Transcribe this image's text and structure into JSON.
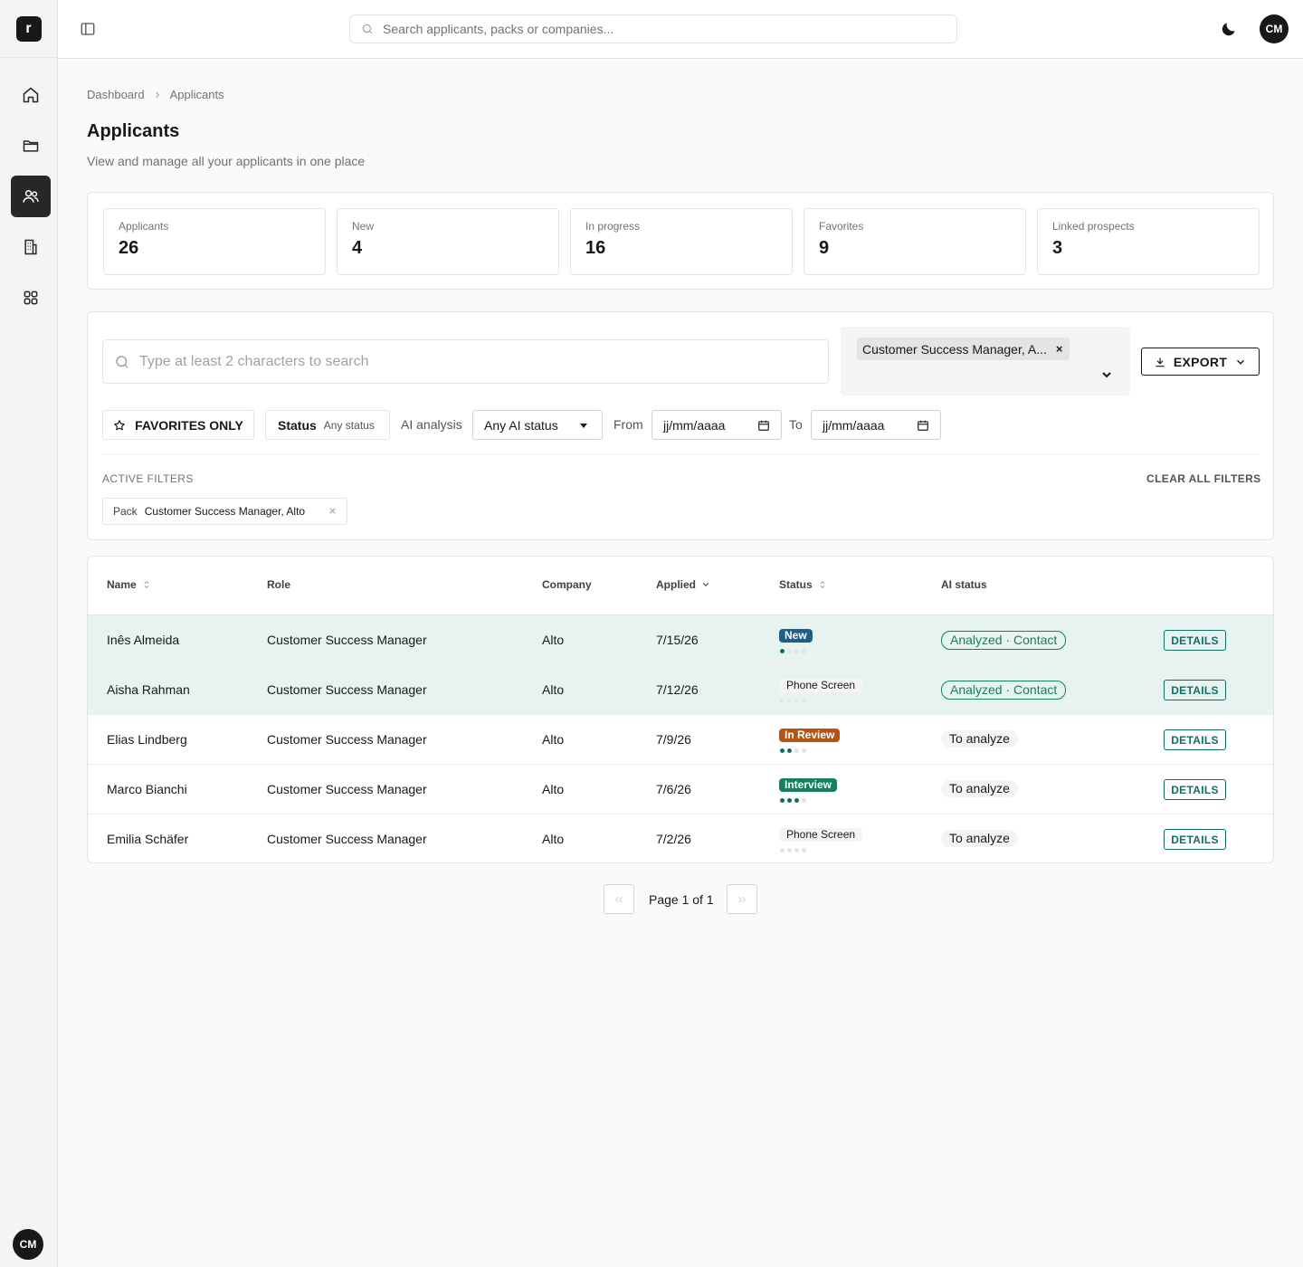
{
  "app": {
    "logo_letter": "r"
  },
  "sidebar": {
    "items": [
      {
        "name": "home",
        "icon": "home-icon"
      },
      {
        "name": "packs",
        "icon": "folder-icon"
      },
      {
        "name": "applicants",
        "icon": "users-icon",
        "active": true
      },
      {
        "name": "companies",
        "icon": "building-icon"
      },
      {
        "name": "apps",
        "icon": "grid-icon"
      }
    ],
    "avatar_initials": "CM"
  },
  "header": {
    "search_placeholder": "Search applicants, packs or companies...",
    "avatar_initials": "CM"
  },
  "breadcrumb": [
    "Dashboard",
    "Applicants"
  ],
  "page": {
    "title": "Applicants",
    "subtitle": "View and manage all your applicants in one place"
  },
  "stats": [
    {
      "label": "Applicants",
      "value": "26"
    },
    {
      "label": "New",
      "value": "4"
    },
    {
      "label": "In progress",
      "value": "16"
    },
    {
      "label": "Favorites",
      "value": "9"
    },
    {
      "label": "Linked prospects",
      "value": "3"
    }
  ],
  "filters": {
    "search_placeholder": "Type at least 2 characters to search",
    "pack_chip": "Customer Success Manager, A...",
    "pack_chip_remove": "×",
    "export_label": "EXPORT",
    "favorites_label": "FAVORITES ONLY",
    "status_key": "Status",
    "status_value": "Any status",
    "ai_label": "AI analysis",
    "ai_value": "Any AI status",
    "from_label": "From",
    "to_label": "To",
    "date_placeholder": "jj/mm/aaaa",
    "active_title": "ACTIVE FILTERS",
    "clear_label": "CLEAR ALL FILTERS",
    "active_chip": {
      "key": "Pack",
      "value": "Customer Success Manager, Alto"
    }
  },
  "table": {
    "columns": {
      "name": "Name",
      "role": "Role",
      "company": "Company",
      "applied": "Applied",
      "status": "Status",
      "ai_status": "AI status"
    },
    "details_label": "DETAILS",
    "rows": [
      {
        "name": "Inês Almeida",
        "role": "Customer Success Manager",
        "company": "Alto",
        "applied": "7/15/26",
        "status": "New",
        "status_kind": "new",
        "progress_steps": 1,
        "ai_status": "Analyzed · Contact",
        "ai_kind": "done",
        "highlight": true
      },
      {
        "name": "Aisha Rahman",
        "role": "Customer Success Manager",
        "company": "Alto",
        "applied": "7/12/26",
        "status": "Phone Screen",
        "status_kind": "phone",
        "progress_steps": 0,
        "ai_status": "Analyzed · Contact",
        "ai_kind": "done",
        "highlight": true
      },
      {
        "name": "Elias Lindberg",
        "role": "Customer Success Manager",
        "company": "Alto",
        "applied": "7/9/26",
        "status": "In Review",
        "status_kind": "review",
        "progress_steps": 2,
        "ai_status": "To analyze",
        "ai_kind": "todo",
        "highlight": false
      },
      {
        "name": "Marco Bianchi",
        "role": "Customer Success Manager",
        "company": "Alto",
        "applied": "7/6/26",
        "status": "Interview",
        "status_kind": "interview",
        "progress_steps": 3,
        "ai_status": "To analyze",
        "ai_kind": "todo",
        "highlight": false
      },
      {
        "name": "Emilia Schäfer",
        "role": "Customer Success Manager",
        "company": "Alto",
        "applied": "7/2/26",
        "status": "Phone Screen",
        "status_kind": "phone",
        "progress_steps": 0,
        "ai_status": "To analyze",
        "ai_kind": "todo",
        "highlight": false
      }
    ]
  },
  "pagination": {
    "label": "Page 1 of 1"
  }
}
